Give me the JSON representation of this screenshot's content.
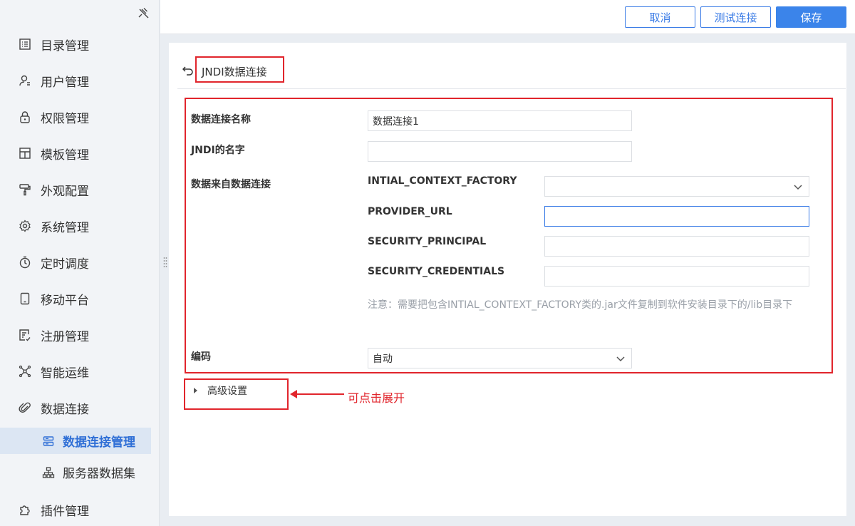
{
  "sidebar": {
    "items": [
      {
        "label": "目录管理",
        "icon": "list-icon"
      },
      {
        "label": "用户管理",
        "icon": "user-icon"
      },
      {
        "label": "权限管理",
        "icon": "lock-icon"
      },
      {
        "label": "模板管理",
        "icon": "template-icon"
      },
      {
        "label": "外观配置",
        "icon": "paint-roller-icon"
      },
      {
        "label": "系统管理",
        "icon": "gear-icon"
      },
      {
        "label": "定时调度",
        "icon": "timer-icon"
      },
      {
        "label": "移动平台",
        "icon": "tablet-icon"
      },
      {
        "label": "注册管理",
        "icon": "register-icon"
      },
      {
        "label": "智能运维",
        "icon": "network-icon"
      },
      {
        "label": "数据连接",
        "icon": "paperclip-icon"
      }
    ],
    "sub_items": [
      {
        "label": "数据连接管理",
        "icon": "database-icon",
        "active": true
      },
      {
        "label": "服务器数据集",
        "icon": "hierarchy-icon",
        "active": false
      }
    ],
    "bottom_item": {
      "label": "插件管理",
      "icon": "puzzle-icon"
    }
  },
  "toolbar": {
    "cancel_label": "取消",
    "test_label": "测试连接",
    "save_label": "保存"
  },
  "page": {
    "title": "JNDI数据连接"
  },
  "form": {
    "connection_name_label": "数据连接名称",
    "connection_name_value": "数据连接1",
    "jndi_name_label": "JNDI的名字",
    "jndi_name_value": "",
    "source_label": "数据来自数据连接",
    "context_factory_label": "INTIAL_CONTEXT_FACTORY",
    "context_factory_value": "",
    "provider_url_label": "PROVIDER_URL",
    "provider_url_value": "",
    "security_principal_label": "SECURITY_PRINCIPAL",
    "security_principal_value": "",
    "security_credentials_label": "SECURITY_CREDENTIALS",
    "security_credentials_value": "",
    "note": "注意：需要把包含INTIAL_CONTEXT_FACTORY类的.jar文件复制到软件安装目录下的/lib目录下",
    "encoding_label": "编码",
    "encoding_value": "自动"
  },
  "advanced": {
    "label": "高级设置"
  },
  "annotation": {
    "callout": "可点击展开",
    "color": "#e1252c"
  },
  "colors": {
    "accent": "#3b84ea",
    "active_bg": "#dce6f3"
  }
}
